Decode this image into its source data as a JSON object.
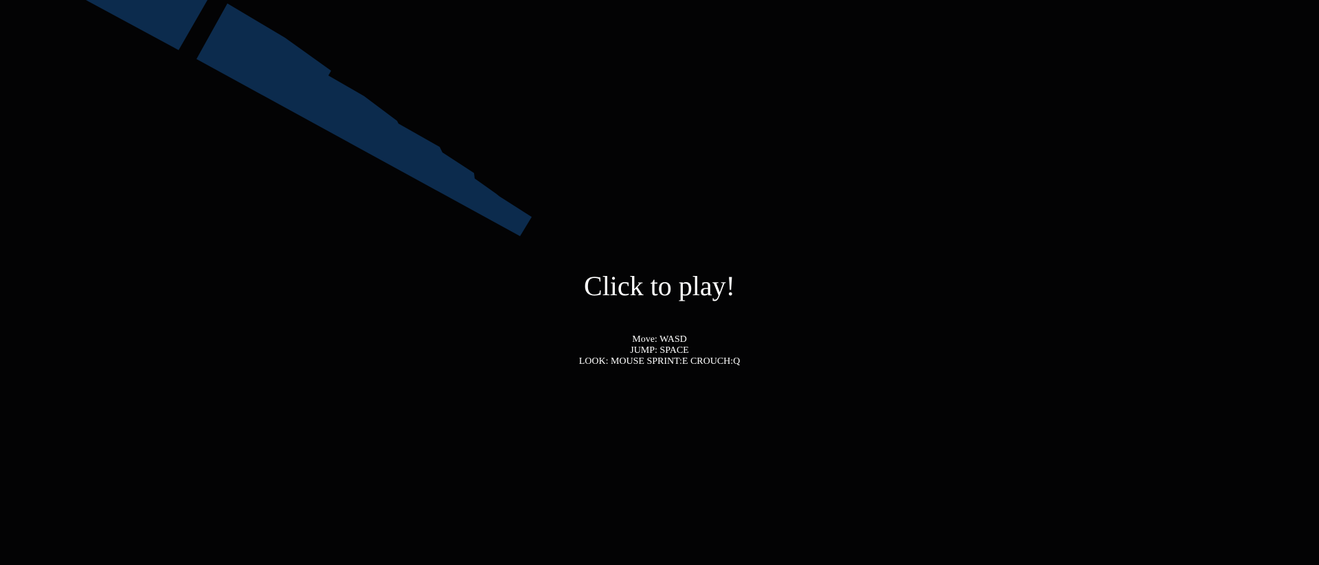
{
  "overlay": {
    "title": "Click to play!",
    "controls": [
      "Move: WASD",
      "JUMP: SPACE",
      "LOOK: MOUSE SPRINT:E CROUCH:Q"
    ]
  },
  "colors": {
    "background": "#030304",
    "geometry": "#0c2b4d",
    "text": "#ffffff"
  }
}
